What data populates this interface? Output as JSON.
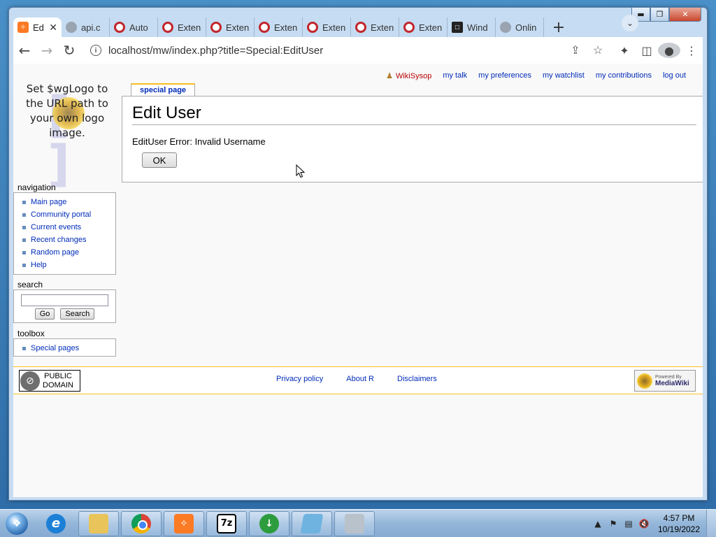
{
  "browser": {
    "tabs": [
      {
        "label": "Ed",
        "icon": "xampp-icon",
        "active": true
      },
      {
        "label": "api.c",
        "icon": "globe-icon"
      },
      {
        "label": "Auto",
        "icon": "opera-icon"
      },
      {
        "label": "Exten",
        "icon": "opera-icon"
      },
      {
        "label": "Exten",
        "icon": "opera-icon"
      },
      {
        "label": "Exten",
        "icon": "opera-icon"
      },
      {
        "label": "Exten",
        "icon": "opera-icon"
      },
      {
        "label": "Exten",
        "icon": "opera-icon"
      },
      {
        "label": "Exten",
        "icon": "opera-icon"
      },
      {
        "label": "Wind",
        "icon": "bank-icon"
      },
      {
        "label": "Onlin",
        "icon": "globe-icon"
      }
    ],
    "url": "localhost/mw/index.php?title=Special:EditUser"
  },
  "personal": {
    "user": "WikiSysop",
    "my_talk": "my talk",
    "my_preferences": "my preferences",
    "my_watchlist": "my watchlist",
    "my_contributions": "my contributions",
    "log_out": "log out"
  },
  "logo": {
    "text": "Set $wgLogo to the URL path to your own logo image."
  },
  "content": {
    "tab_label": "special page",
    "title": "Edit User",
    "message": "EditUser Error: Invalid Username",
    "ok_label": "OK"
  },
  "sidebar": {
    "navigation_heading": "navigation",
    "navigation": [
      "Main page",
      "Community portal",
      "Current events",
      "Recent changes",
      "Random page",
      "Help"
    ],
    "search_heading": "search",
    "go_label": "Go",
    "search_label": "Search",
    "toolbox_heading": "toolbox",
    "toolbox": [
      "Special pages"
    ]
  },
  "footer": {
    "pd_line1": "PUBLIC",
    "pd_line2": "DOMAIN",
    "links": [
      "Privacy policy",
      "About R",
      "Disclaimers"
    ],
    "mw_small": "Powered By",
    "mw_big": "MediaWiki"
  },
  "taskbar": {
    "time": "4:57 PM",
    "date": "10/19/2022"
  },
  "colors": {
    "link": "#002bb8",
    "user_link": "#ba0000",
    "tab_accent": "#fabd23"
  }
}
